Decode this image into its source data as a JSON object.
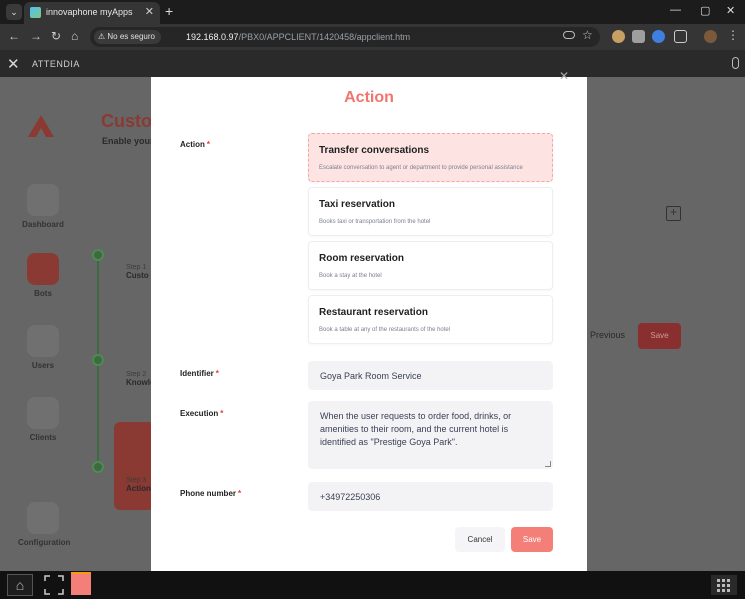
{
  "browser": {
    "tab_title": "innovaphone myApps",
    "security_label": "No es seguro",
    "url_host": "192.168.0.97",
    "url_path": "/PBX0/APPCLIENT/1420458/appclient.htm"
  },
  "app": {
    "title": "ATTENDIA"
  },
  "background": {
    "heading": "Custo",
    "subheading": "Enable your",
    "sidebar": [
      {
        "label": "Dashboard"
      },
      {
        "label": "Bots"
      },
      {
        "label": "Users"
      },
      {
        "label": "Clients"
      },
      {
        "label": "Configuration"
      }
    ],
    "steps": [
      {
        "num": "Step 1",
        "title": "Custo"
      },
      {
        "num": "Step 2",
        "title": "Knowle"
      },
      {
        "num": "Step 3",
        "title": "Action"
      }
    ],
    "previous_label": "Previous",
    "save_label": "Save"
  },
  "modal": {
    "title": "Action",
    "action_label": "Action",
    "options": [
      {
        "title": "Transfer conversations",
        "desc": "Escalate conversation to agent or department to provide personal assistance",
        "selected": true
      },
      {
        "title": "Taxi reservation",
        "desc": "Books taxi or transportation from the hotel",
        "selected": false
      },
      {
        "title": "Room reservation",
        "desc": "Book a stay at the hotel",
        "selected": false
      },
      {
        "title": "Restaurant reservation",
        "desc": "Book a table at any of the restaurants of the hotel",
        "selected": false
      }
    ],
    "identifier_label": "Identifier",
    "identifier_value": "Goya Park Room Service",
    "execution_label": "Execution",
    "execution_value": "When the user requests to order food, drinks, or amenities to their room, and the current hotel is identified as \"Prestige Goya Park\".",
    "phone_label": "Phone number",
    "phone_value": "+34972250306",
    "cancel_label": "Cancel",
    "save_label": "Save"
  },
  "colors": {
    "accent": "#f47f79",
    "title": "#f2756d",
    "selected_bg": "#fde4e2"
  }
}
